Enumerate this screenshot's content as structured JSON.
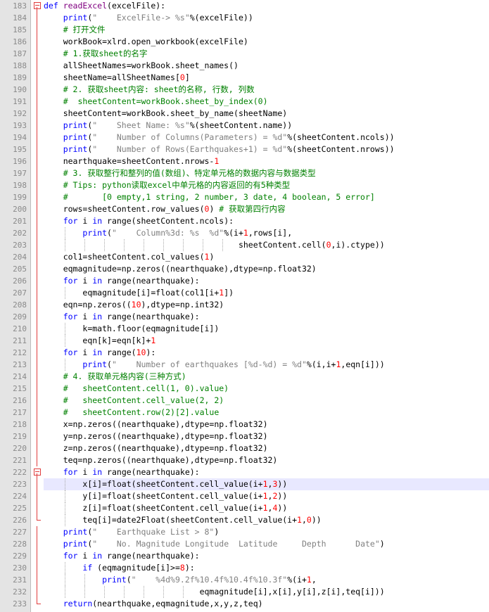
{
  "editor": {
    "current_line": 223,
    "lines": [
      {
        "n": "183",
        "fold": "box",
        "tokens": [
          [
            "kw",
            "def "
          ],
          [
            "bi",
            "readExcel"
          ],
          [
            "op",
            "(excelFile):"
          ]
        ]
      },
      {
        "n": "184",
        "fold": "line",
        "tokens": [
          [
            "ind",
            "    "
          ],
          [
            "kw",
            "print"
          ],
          [
            "op",
            "("
          ],
          [
            "str",
            "\"    ExcelFile-> %s\""
          ],
          [
            "op",
            "%(excelFile))"
          ]
        ]
      },
      {
        "n": "185",
        "fold": "line",
        "tokens": [
          [
            "ind",
            "    "
          ],
          [
            "cm",
            "# 打开文件"
          ]
        ]
      },
      {
        "n": "186",
        "fold": "line",
        "tokens": [
          [
            "ind",
            "    "
          ],
          [
            "op",
            "workBook=xlrd.open_workbook(excelFile)"
          ]
        ]
      },
      {
        "n": "187",
        "fold": "line",
        "tokens": [
          [
            "ind",
            "    "
          ],
          [
            "cm",
            "# 1.获取sheet的名字"
          ]
        ]
      },
      {
        "n": "188",
        "fold": "line",
        "tokens": [
          [
            "ind",
            "    "
          ],
          [
            "op",
            "allSheetNames=workBook.sheet_names()"
          ]
        ]
      },
      {
        "n": "189",
        "fold": "line",
        "tokens": [
          [
            "ind",
            "    "
          ],
          [
            "op",
            "sheetName=allSheetNames["
          ],
          [
            "num",
            "0"
          ],
          [
            "op",
            "]"
          ]
        ]
      },
      {
        "n": "190",
        "fold": "line",
        "tokens": [
          [
            "ind",
            "    "
          ],
          [
            "cm",
            "# 2. 获取sheet内容: sheet的名称, 行数, 列数"
          ]
        ]
      },
      {
        "n": "191",
        "fold": "line",
        "tokens": [
          [
            "ind",
            "    "
          ],
          [
            "cm",
            "#  sheetContent=workBook.sheet_by_index(0)"
          ]
        ]
      },
      {
        "n": "192",
        "fold": "line",
        "tokens": [
          [
            "ind",
            "    "
          ],
          [
            "op",
            "sheetContent=workBook.sheet_by_name(sheetName)"
          ]
        ]
      },
      {
        "n": "193",
        "fold": "line",
        "tokens": [
          [
            "ind",
            "    "
          ],
          [
            "kw",
            "print"
          ],
          [
            "op",
            "("
          ],
          [
            "str",
            "\"    Sheet Name: %s\""
          ],
          [
            "op",
            "%(sheetContent.name))"
          ]
        ]
      },
      {
        "n": "194",
        "fold": "line",
        "tokens": [
          [
            "ind",
            "    "
          ],
          [
            "kw",
            "print"
          ],
          [
            "op",
            "("
          ],
          [
            "str",
            "\"    Number of Columns(Parameters) = %d\""
          ],
          [
            "op",
            "%(sheetContent.ncols))"
          ]
        ]
      },
      {
        "n": "195",
        "fold": "line",
        "tokens": [
          [
            "ind",
            "    "
          ],
          [
            "kw",
            "print"
          ],
          [
            "op",
            "("
          ],
          [
            "str",
            "\"    Number of Rows(Earthquakes+1) = %d\""
          ],
          [
            "op",
            "%(sheetContent.nrows))"
          ]
        ]
      },
      {
        "n": "196",
        "fold": "line",
        "tokens": [
          [
            "ind",
            "    "
          ],
          [
            "op",
            "nearthquake=sheetContent.nrows-"
          ],
          [
            "num",
            "1"
          ]
        ]
      },
      {
        "n": "197",
        "fold": "line",
        "tokens": [
          [
            "ind",
            "    "
          ],
          [
            "cm",
            "# 3. 获取整行和整列的值(数组)、特定单元格的数据内容与数据类型"
          ]
        ]
      },
      {
        "n": "198",
        "fold": "line",
        "tokens": [
          [
            "ind",
            "    "
          ],
          [
            "cm",
            "# Tips: python读取excel中单元格的内容返回的有5种类型"
          ]
        ]
      },
      {
        "n": "199",
        "fold": "line",
        "tokens": [
          [
            "ind",
            "    "
          ],
          [
            "cm",
            "#       [0 empty,1 string, 2 number, 3 date, 4 boolean, 5 error]"
          ]
        ]
      },
      {
        "n": "200",
        "fold": "line",
        "tokens": [
          [
            "ind",
            "    "
          ],
          [
            "op",
            "rows=sheetContent.row_values("
          ],
          [
            "num",
            "0"
          ],
          [
            "op",
            ") "
          ],
          [
            "cm",
            "# 获取第四行内容"
          ]
        ]
      },
      {
        "n": "201",
        "fold": "line",
        "tokens": [
          [
            "ind",
            "    "
          ],
          [
            "kw",
            "for"
          ],
          [
            "op",
            " i "
          ],
          [
            "kw",
            "in"
          ],
          [
            "op",
            " range(sheetContent.ncols):"
          ]
        ]
      },
      {
        "n": "202",
        "fold": "line",
        "tokens": [
          [
            "ind",
            "        "
          ],
          [
            "kw",
            "print"
          ],
          [
            "op",
            "("
          ],
          [
            "str",
            "\"    Column%3d: %s  %d\""
          ],
          [
            "op",
            "%(i+"
          ],
          [
            "num",
            "1"
          ],
          [
            "op",
            ",rows[i],"
          ]
        ]
      },
      {
        "n": "203",
        "fold": "line",
        "tokens": [
          [
            "ind",
            "                                        "
          ],
          [
            "op",
            "sheetContent.cell("
          ],
          [
            "num",
            "0"
          ],
          [
            "op",
            ",i).ctype))"
          ]
        ]
      },
      {
        "n": "204",
        "fold": "line",
        "tokens": [
          [
            "ind",
            "    "
          ],
          [
            "op",
            "col1=sheetContent.col_values("
          ],
          [
            "num",
            "1"
          ],
          [
            "op",
            ")"
          ]
        ]
      },
      {
        "n": "205",
        "fold": "line",
        "tokens": [
          [
            "ind",
            "    "
          ],
          [
            "op",
            "eqmagnitude=np.zeros((nearthquake),dtype=np.float32)"
          ]
        ]
      },
      {
        "n": "206",
        "fold": "line",
        "tokens": [
          [
            "ind",
            "    "
          ],
          [
            "kw",
            "for"
          ],
          [
            "op",
            " i "
          ],
          [
            "kw",
            "in"
          ],
          [
            "op",
            " range(nearthquake):"
          ]
        ]
      },
      {
        "n": "207",
        "fold": "line",
        "tokens": [
          [
            "ind",
            "        "
          ],
          [
            "op",
            "eqmagnitude[i]=float(col1[i+"
          ],
          [
            "num",
            "1"
          ],
          [
            "op",
            "])"
          ]
        ]
      },
      {
        "n": "208",
        "fold": "line",
        "tokens": [
          [
            "ind",
            "    "
          ],
          [
            "op",
            "eqn=np.zeros(("
          ],
          [
            "num",
            "10"
          ],
          [
            "op",
            "),dtype=np.int32)"
          ]
        ]
      },
      {
        "n": "209",
        "fold": "line",
        "tokens": [
          [
            "ind",
            "    "
          ],
          [
            "kw",
            "for"
          ],
          [
            "op",
            " i "
          ],
          [
            "kw",
            "in"
          ],
          [
            "op",
            " range(nearthquake):"
          ]
        ]
      },
      {
        "n": "210",
        "fold": "line",
        "tokens": [
          [
            "ind",
            "        "
          ],
          [
            "op",
            "k=math.floor(eqmagnitude[i])"
          ]
        ]
      },
      {
        "n": "211",
        "fold": "line",
        "tokens": [
          [
            "ind",
            "        "
          ],
          [
            "op",
            "eqn[k]=eqn[k]+"
          ],
          [
            "num",
            "1"
          ]
        ]
      },
      {
        "n": "212",
        "fold": "line",
        "tokens": [
          [
            "ind",
            "    "
          ],
          [
            "kw",
            "for"
          ],
          [
            "op",
            " i "
          ],
          [
            "kw",
            "in"
          ],
          [
            "op",
            " range("
          ],
          [
            "num",
            "10"
          ],
          [
            "op",
            "):"
          ]
        ]
      },
      {
        "n": "213",
        "fold": "line",
        "tokens": [
          [
            "ind",
            "        "
          ],
          [
            "kw",
            "print"
          ],
          [
            "op",
            "("
          ],
          [
            "str",
            "\"    Number of earthquakes [%d-%d) = %d\""
          ],
          [
            "op",
            "%(i,i+"
          ],
          [
            "num",
            "1"
          ],
          [
            "op",
            ",eqn[i]))"
          ]
        ]
      },
      {
        "n": "214",
        "fold": "line",
        "tokens": [
          [
            "ind",
            "    "
          ],
          [
            "cm",
            "# 4. 获取单元格内容(三种方式)"
          ]
        ]
      },
      {
        "n": "215",
        "fold": "line",
        "tokens": [
          [
            "ind",
            "    "
          ],
          [
            "cm",
            "#   sheetContent.cell(1, 0).value)"
          ]
        ]
      },
      {
        "n": "216",
        "fold": "line",
        "tokens": [
          [
            "ind",
            "    "
          ],
          [
            "cm",
            "#   sheetContent.cell_value(2, 2)"
          ]
        ]
      },
      {
        "n": "217",
        "fold": "line",
        "tokens": [
          [
            "ind",
            "    "
          ],
          [
            "cm",
            "#   sheetContent.row(2)[2].value"
          ]
        ]
      },
      {
        "n": "218",
        "fold": "line",
        "tokens": [
          [
            "ind",
            "    "
          ],
          [
            "op",
            "x=np.zeros((nearthquake),dtype=np.float32)"
          ]
        ]
      },
      {
        "n": "219",
        "fold": "line",
        "tokens": [
          [
            "ind",
            "    "
          ],
          [
            "op",
            "y=np.zeros((nearthquake),dtype=np.float32)"
          ]
        ]
      },
      {
        "n": "220",
        "fold": "line",
        "tokens": [
          [
            "ind",
            "    "
          ],
          [
            "op",
            "z=np.zeros((nearthquake),dtype=np.float32)"
          ]
        ]
      },
      {
        "n": "221",
        "fold": "line",
        "tokens": [
          [
            "ind",
            "    "
          ],
          [
            "op",
            "teq=np.zeros((nearthquake),dtype=np.float32)"
          ]
        ]
      },
      {
        "n": "222",
        "fold": "box",
        "tokens": [
          [
            "ind",
            "    "
          ],
          [
            "kw",
            "for"
          ],
          [
            "op",
            " i "
          ],
          [
            "kw",
            "in"
          ],
          [
            "op",
            " range(nearthquake):"
          ]
        ]
      },
      {
        "n": "223",
        "fold": "line",
        "tokens": [
          [
            "ind",
            "        "
          ],
          [
            "op",
            "x[i]=float(sheetContent.cell_value(i+"
          ],
          [
            "num",
            "1"
          ],
          [
            "op",
            ","
          ],
          [
            "num",
            "3"
          ],
          [
            "op",
            "))"
          ]
        ]
      },
      {
        "n": "224",
        "fold": "line",
        "tokens": [
          [
            "ind",
            "        "
          ],
          [
            "op",
            "y[i]=float(sheetContent.cell_value(i+"
          ],
          [
            "num",
            "1"
          ],
          [
            "op",
            ","
          ],
          [
            "num",
            "2"
          ],
          [
            "op",
            "))"
          ]
        ]
      },
      {
        "n": "225",
        "fold": "line",
        "tokens": [
          [
            "ind",
            "        "
          ],
          [
            "op",
            "z[i]=float(sheetContent.cell_value(i+"
          ],
          [
            "num",
            "1"
          ],
          [
            "op",
            ","
          ],
          [
            "num",
            "4"
          ],
          [
            "op",
            "))"
          ]
        ]
      },
      {
        "n": "226",
        "fold": "corner",
        "tokens": [
          [
            "ind",
            "        "
          ],
          [
            "op",
            "teq[i]=date2Float(sheetContent.cell_value(i+"
          ],
          [
            "num",
            "1"
          ],
          [
            "op",
            ","
          ],
          [
            "num",
            "0"
          ],
          [
            "op",
            "))"
          ]
        ]
      },
      {
        "n": "227",
        "fold": "line",
        "tokens": [
          [
            "ind",
            "    "
          ],
          [
            "kw",
            "print"
          ],
          [
            "op",
            "("
          ],
          [
            "str",
            "\"    Earthquake List > 8\""
          ],
          [
            "op",
            ")"
          ]
        ]
      },
      {
        "n": "228",
        "fold": "line",
        "tokens": [
          [
            "ind",
            "    "
          ],
          [
            "kw",
            "print"
          ],
          [
            "op",
            "("
          ],
          [
            "str",
            "\"    No. Magnitude Longitude  Latitude     Depth      Date\""
          ],
          [
            "op",
            ")"
          ]
        ]
      },
      {
        "n": "229",
        "fold": "line",
        "tokens": [
          [
            "ind",
            "    "
          ],
          [
            "kw",
            "for"
          ],
          [
            "op",
            " i "
          ],
          [
            "kw",
            "in"
          ],
          [
            "op",
            " range(nearthquake):"
          ]
        ]
      },
      {
        "n": "230",
        "fold": "line",
        "tokens": [
          [
            "ind",
            "        "
          ],
          [
            "kw",
            "if"
          ],
          [
            "op",
            " (eqmagnitude[i]>="
          ],
          [
            "num",
            "8"
          ],
          [
            "op",
            "):"
          ]
        ]
      },
      {
        "n": "231",
        "fold": "line",
        "tokens": [
          [
            "ind",
            "            "
          ],
          [
            "kw",
            "print"
          ],
          [
            "op",
            "("
          ],
          [
            "str",
            "\"    %4d%9.2f%10.4f%10.4f%10.3f\""
          ],
          [
            "op",
            "%(i+"
          ],
          [
            "num",
            "1"
          ],
          [
            "op",
            ","
          ]
        ]
      },
      {
        "n": "232",
        "fold": "line",
        "tokens": [
          [
            "ind",
            "                                "
          ],
          [
            "op",
            "eqmagnitude[i],x[i],y[i],z[i],teq[i]))"
          ]
        ]
      },
      {
        "n": "233",
        "fold": "corner",
        "tokens": [
          [
            "ind",
            "    "
          ],
          [
            "kw",
            "return"
          ],
          [
            "op",
            "(nearthquake,eqmagnitude,x,y,z,teq)"
          ]
        ]
      }
    ]
  }
}
